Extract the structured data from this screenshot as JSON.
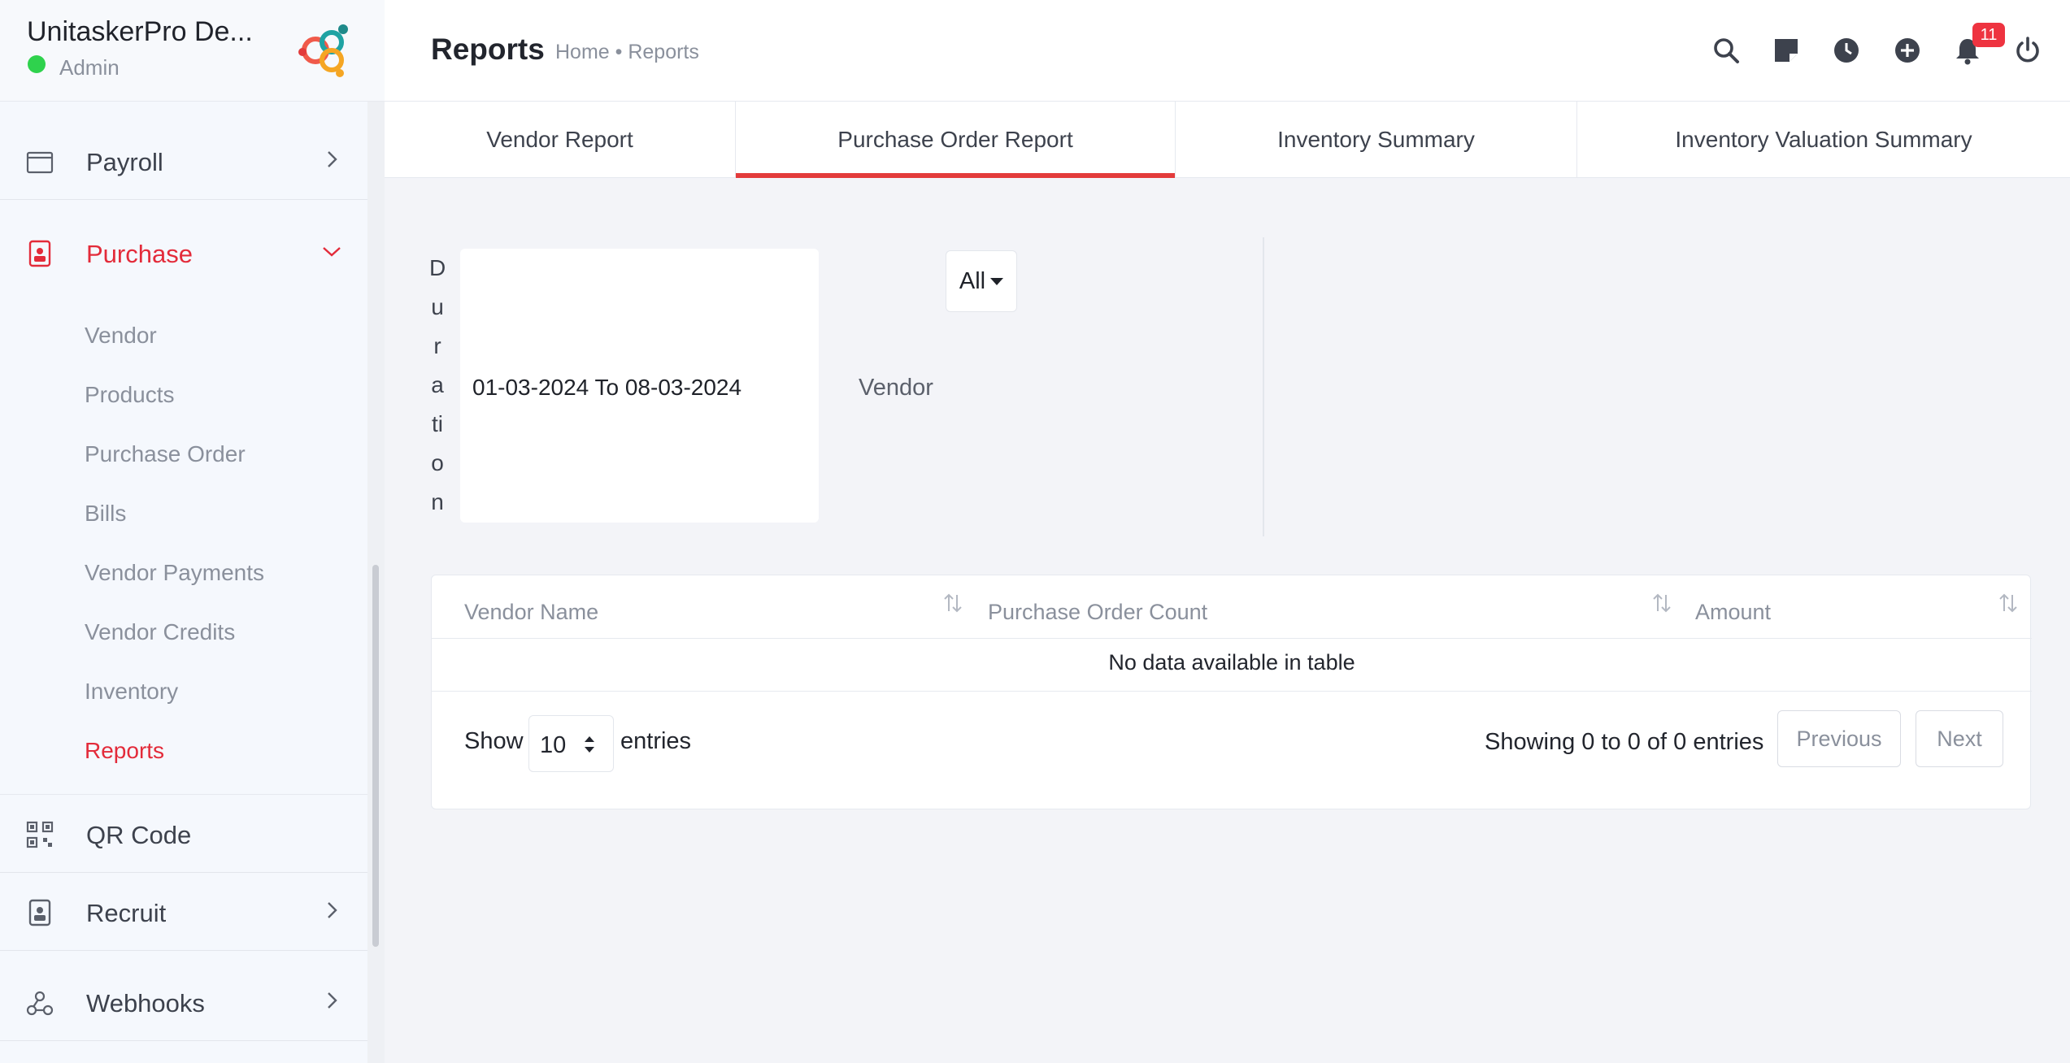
{
  "brand": {
    "name": "UnitaskerPro De...",
    "role": "Admin",
    "status_color": "#2fd24d"
  },
  "sidebar": {
    "items": [
      {
        "label": "Payroll",
        "icon": "wallet-icon"
      },
      {
        "label": "Purchase",
        "icon": "purchase-icon",
        "active": true
      },
      {
        "label": "QR Code",
        "icon": "qr-code-icon"
      },
      {
        "label": "Recruit",
        "icon": "recruit-icon"
      },
      {
        "label": "Webhooks",
        "icon": "webhooks-icon"
      }
    ],
    "purchase_sub": [
      "Vendor",
      "Products",
      "Purchase Order",
      "Bills",
      "Vendor Payments",
      "Vendor Credits",
      "Inventory",
      "Reports"
    ],
    "active_sub": "Reports",
    "accent_color": "#e32b3a"
  },
  "header": {
    "title": "Reports",
    "breadcrumb": "Home • Reports",
    "notification_count": "11",
    "icons": [
      "search-icon",
      "note-icon",
      "clock-icon",
      "add-icon",
      "bell-icon",
      "power-icon"
    ]
  },
  "tabs": [
    {
      "label": "Vendor Report"
    },
    {
      "label": "Purchase Order Report",
      "active": true
    },
    {
      "label": "Inventory Summary"
    },
    {
      "label": "Inventory Valuation Summary"
    }
  ],
  "filters": {
    "duration_label": "Duration",
    "duration_letters": [
      "D",
      "u",
      "r",
      "a",
      "ti",
      "o",
      "n"
    ],
    "date_range": "01-03-2024 To 08-03-2024",
    "vendor_label": "Vendor",
    "vendor_selected": "All"
  },
  "table": {
    "columns": [
      "Vendor Name",
      "Purchase Order Count",
      "Amount"
    ],
    "empty_message": "No data available in table",
    "show_label": "Show",
    "page_size": "10",
    "entries_label": "entries",
    "info": "Showing 0 to 0 of 0 entries",
    "prev_label": "Previous",
    "next_label": "Next"
  }
}
